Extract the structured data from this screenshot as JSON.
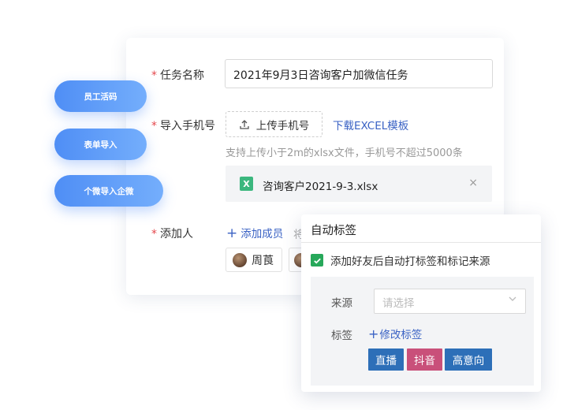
{
  "side_pills": [
    "员工活码",
    "表单导入",
    "个微导入企微"
  ],
  "form": {
    "task_name": {
      "label": "任务名称",
      "value": "2021年9月3日咨询客户加微信任务"
    },
    "import_phone": {
      "label": "导入手机号",
      "upload_label": "上传手机号",
      "download_link": "下载EXCEL模板",
      "hint": "支持上传小于2m的xlsx文件，手机号不超过5000条",
      "file": {
        "icon_text": "X",
        "name": "咨询客户2021-9-3.xlsx",
        "close": "×"
      }
    },
    "adder": {
      "label": "添加人",
      "add_member": "添加成员",
      "extra_text": "将",
      "members": [
        "周莨"
      ]
    }
  },
  "auto_tag_panel": {
    "title": "自动标签",
    "checkbox_label": "添加好友后自动打标签和标记来源",
    "checked": true,
    "source_label": "来源",
    "source_placeholder": "请选择",
    "tag_label": "标签",
    "edit_tag": "修改标签",
    "tags": [
      {
        "label": "直播",
        "color": "#2d6fb8"
      },
      {
        "label": "抖音",
        "color": "#c9507a"
      },
      {
        "label": "高意向",
        "color": "#2d6fb8"
      }
    ]
  },
  "colors": {
    "required_star": "#e5484d",
    "link": "#3a62c4",
    "checkbox": "#27a85a",
    "pill": "#5b97f7"
  }
}
